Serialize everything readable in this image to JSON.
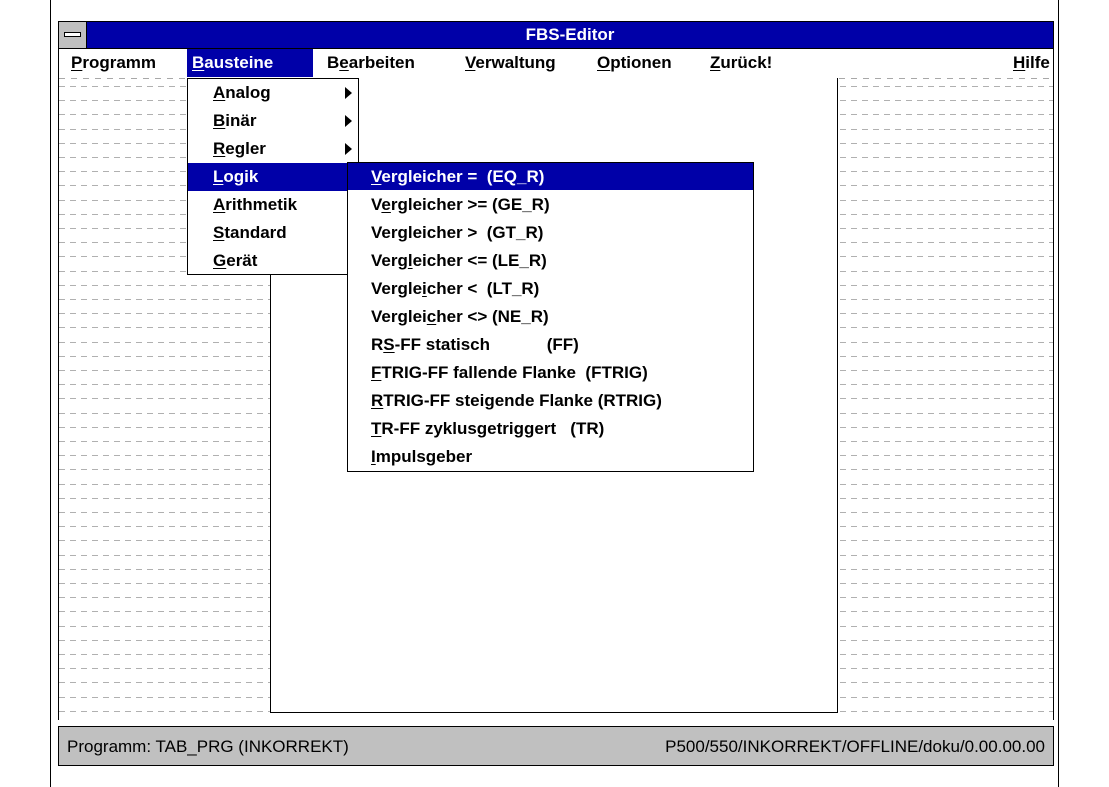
{
  "window": {
    "title": "FBS-Editor"
  },
  "menubar": {
    "items": [
      {
        "pre": "",
        "u": "P",
        "post": "rogramm"
      },
      {
        "pre": "",
        "u": "B",
        "post": "austeine"
      },
      {
        "pre": "B",
        "u": "e",
        "post": "arbeiten"
      },
      {
        "pre": "",
        "u": "V",
        "post": "erwaltung"
      },
      {
        "pre": "",
        "u": "O",
        "post": "ptionen"
      },
      {
        "pre": "",
        "u": "Z",
        "post": "urück!"
      },
      {
        "pre": "",
        "u": "H",
        "post": "ilfe"
      }
    ],
    "active_index": 1
  },
  "bausteine_menu": {
    "items": [
      {
        "pre": "",
        "u": "A",
        "post": "nalog",
        "submenu": true
      },
      {
        "pre": "",
        "u": "B",
        "post": "inär",
        "submenu": true
      },
      {
        "pre": "",
        "u": "R",
        "post": "egler",
        "submenu": true
      },
      {
        "pre": "",
        "u": "L",
        "post": "ogik",
        "submenu": false
      },
      {
        "pre": "",
        "u": "A",
        "post": "rithmetik",
        "submenu": false
      },
      {
        "pre": "",
        "u": "S",
        "post": "tandard",
        "submenu": false
      },
      {
        "pre": "",
        "u": "G",
        "post": "erät",
        "submenu": false
      }
    ],
    "active_index": 3
  },
  "logik_submenu": {
    "items": [
      {
        "pre": "",
        "u": "V",
        "post": "ergleicher =  (EQ_R)"
      },
      {
        "pre": "V",
        "u": "e",
        "post": "rgleicher >= (GE_R)"
      },
      {
        "pre": "Vergleicher >  (GT_R)",
        "u": "",
        "post": ""
      },
      {
        "pre": "Verg",
        "u": "l",
        "post": "eicher <= (LE_R)"
      },
      {
        "pre": "Vergle",
        "u": "i",
        "post": "cher <  (LT_R)"
      },
      {
        "pre": "Verglei",
        "u": "c",
        "post": "her <> (NE_R)"
      },
      {
        "pre": "R",
        "u": "S",
        "post": "-FF statisch            (FF)"
      },
      {
        "pre": "",
        "u": "F",
        "post": "TRIG-FF fallende Flanke  (FTRIG)"
      },
      {
        "pre": "",
        "u": "R",
        "post": "TRIG-FF steigende Flanke (RTRIG)"
      },
      {
        "pre": "",
        "u": "T",
        "post": "R-FF zyklusgetriggert   (TR)"
      },
      {
        "pre": "",
        "u": "I",
        "post": "mpulsgeber"
      }
    ],
    "active_index": 0
  },
  "statusbar": {
    "left": "Programm: TAB_PRG (INKORREKT)",
    "right": "P500/550/INKORREKT/OFFLINE/doku/0.00.00.00"
  }
}
